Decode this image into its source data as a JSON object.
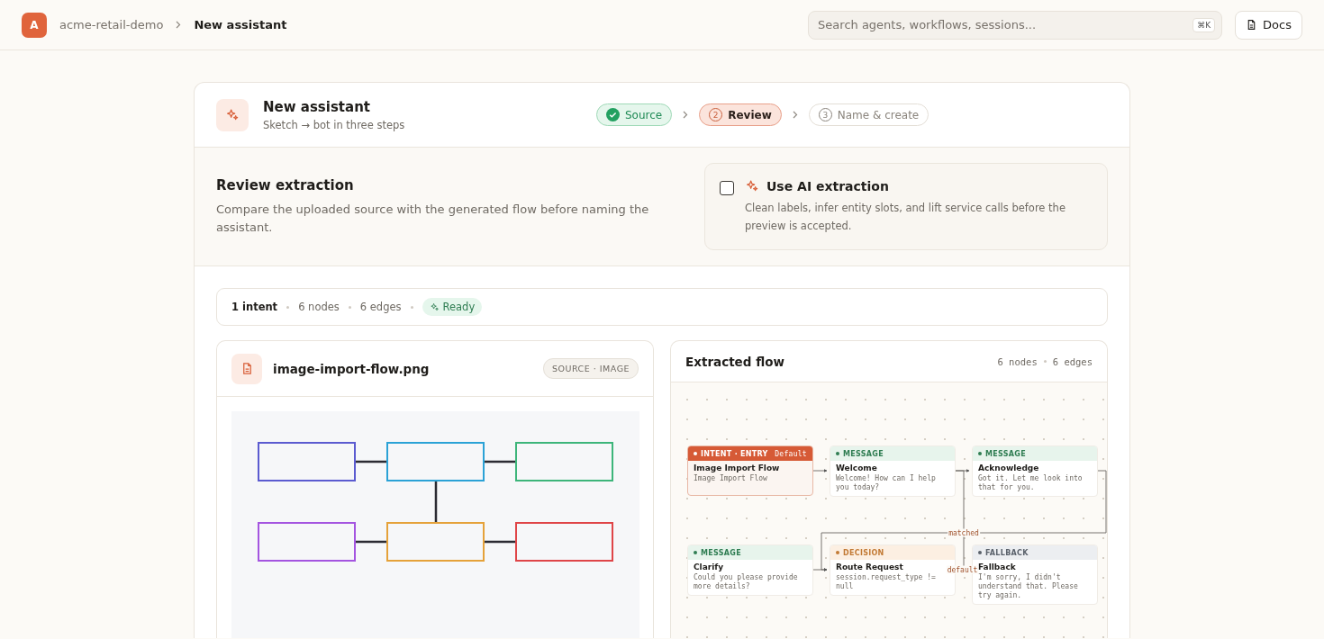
{
  "topbar": {
    "avatar": "A",
    "breadcrumb": [
      {
        "label": "acme-retail-demo",
        "current": false
      },
      {
        "label": "New assistant",
        "current": true
      }
    ],
    "search": {
      "placeholder": "Search agents, workflows, sessions...",
      "shortcut": "⌘K"
    },
    "docs_button": "Docs"
  },
  "wizard": {
    "title": "New assistant",
    "subtitle": "Sketch → bot in three steps",
    "steps": [
      {
        "label": "Source",
        "completed": true,
        "selected": false
      },
      {
        "number": "2",
        "label": "Review",
        "completed": false,
        "selected": true
      },
      {
        "number": "3",
        "label": "Name & create",
        "completed": false,
        "selected": false
      }
    ]
  },
  "review": {
    "title": "Review extraction",
    "description": "Compare the uploaded source with the generated flow before naming the assistant.",
    "ai_option": {
      "label": "Use AI extraction",
      "checked": false,
      "description": "Clean labels, infer entity slots, and lift service calls before the preview is accepted."
    }
  },
  "stats": {
    "items": [
      {
        "text": "1 intent",
        "strong": true
      },
      {
        "text": "6 nodes",
        "strong": false
      },
      {
        "text": "6 edges",
        "strong": false
      }
    ],
    "status": "Ready"
  },
  "source_panel": {
    "filename": "image-import-flow.png",
    "tag": "SOURCE · IMAGE"
  },
  "flow_panel": {
    "title": "Extracted flow",
    "meta": [
      "6 nodes",
      "6 edges"
    ],
    "nodes": [
      {
        "kind": "entry",
        "type_label": "INTENT · ENTRY",
        "badge": "Default",
        "title": "Image Import Flow",
        "body": "Image Import Flow"
      },
      {
        "kind": "message",
        "type_label": "MESSAGE",
        "title": "Welcome",
        "body": "Welcome! How can I help you today?"
      },
      {
        "kind": "message",
        "type_label": "MESSAGE",
        "title": "Acknowledge",
        "body": "Got it. Let me look into that for you."
      },
      {
        "kind": "message",
        "type_label": "MESSAGE",
        "title": "Clarify",
        "body": "Could you please provide more details?"
      },
      {
        "kind": "decision",
        "type_label": "DECISION",
        "title": "Route Request",
        "body": "session.request_type != null"
      },
      {
        "kind": "fallback",
        "type_label": "FALLBACK",
        "title": "Fallback",
        "body": "I'm sorry, I didn't understand that. Please try again."
      }
    ],
    "edge_labels": [
      "matched",
      "default"
    ]
  }
}
